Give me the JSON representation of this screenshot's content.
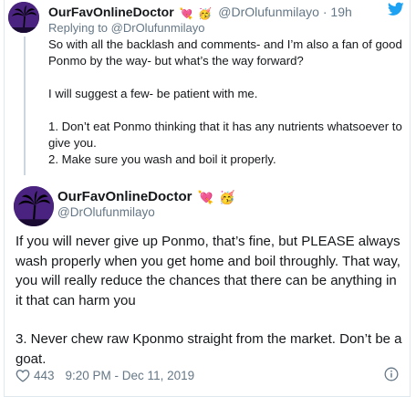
{
  "parent": {
    "name": "OurFavOnlineDoctor",
    "emojis": [
      "💘",
      "🥳"
    ],
    "handle": "@DrOlufunmilayo",
    "separator": "·",
    "time": "19h",
    "reply_to": "Replying to @DrOlufunmilayo",
    "paragraphs": [
      "So with all the backlash and comments- and I’m also a fan of good Ponmo by the way- but what’s the way forward?",
      "I will suggest a few- be patient with me.",
      "1. Don’t eat Ponmo thinking that it has any nutrients whatsoever to give you.\n2. Make sure you wash and boil it properly."
    ]
  },
  "main": {
    "name": "OurFavOnlineDoctor",
    "emojis": [
      "💘",
      "🥳"
    ],
    "handle": "@DrOlufunmilayo",
    "paragraphs": [
      "If you will never give up Ponmo, that’s fine, but PLEASE always wash properly when you get home and boil throughly. That way, you will really reduce the chances that there can be anything in it that can harm you",
      "3. Never chew raw Kponmo straight from the market. Don’t be a goat."
    ],
    "likes": "443",
    "timestamp": "9:20 PM - Dec 11, 2019"
  },
  "colors": {
    "text": "#14171a",
    "secondary": "#657786",
    "twitter_blue": "#1da1f2",
    "avatar_bg": "#3b1c6f"
  },
  "icons": {
    "bird": "twitter-bird-icon",
    "heart": "heart-icon",
    "info": "info-icon"
  }
}
